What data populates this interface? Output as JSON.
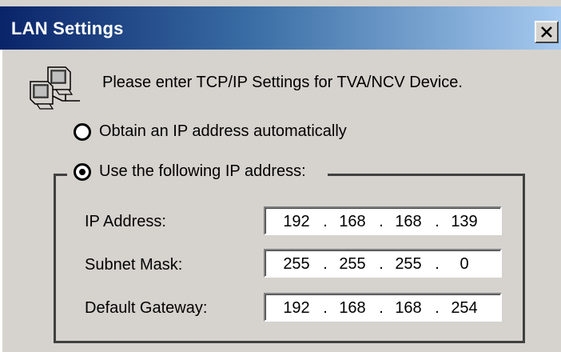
{
  "window": {
    "title": "LAN Settings",
    "close_label": "×"
  },
  "prompt": "Please enter TCP/IP Settings for TVA/NCV Device.",
  "options": {
    "auto": "Obtain an IP address automatically",
    "manual": "Use the following IP address:",
    "selected": "manual"
  },
  "fields": [
    {
      "label": "IP Address:",
      "octets": [
        "192",
        "168",
        "168",
        "139"
      ]
    },
    {
      "label": "Subnet Mask:",
      "octets": [
        "255",
        "255",
        "255",
        "0"
      ]
    },
    {
      "label": "Default Gateway:",
      "octets": [
        "192",
        "168",
        "168",
        "254"
      ]
    }
  ],
  "colors": {
    "titlebar_start": "#0a246a",
    "titlebar_end": "#a6caf0",
    "dialog_bg": "#d6d3ce"
  }
}
